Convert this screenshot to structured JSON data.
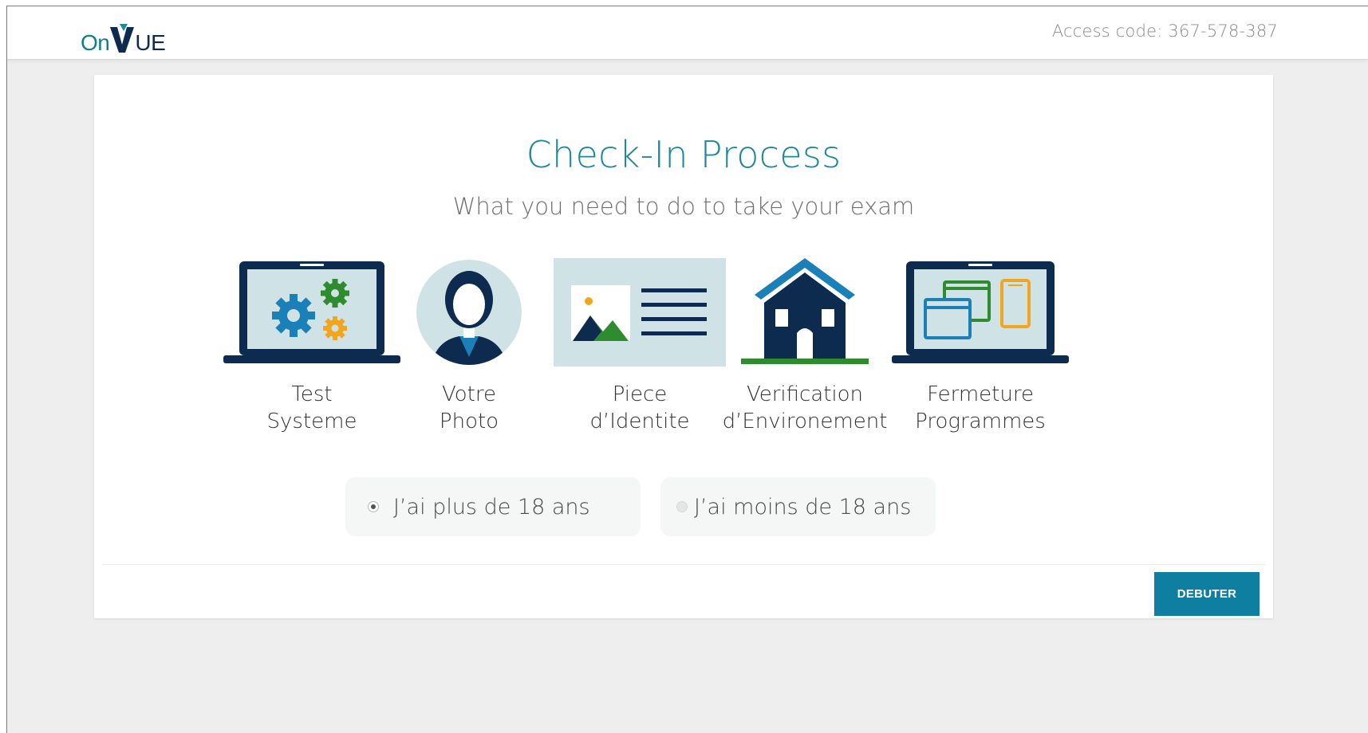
{
  "header": {
    "logo": {
      "on": "On",
      "ue": "UE"
    },
    "access_code": "Access code: 367-578-387"
  },
  "card": {
    "title": "Check-In Process",
    "subtitle": "What you need to do to take your exam",
    "steps": [
      {
        "label": "Test\nSysteme",
        "icon": "laptop-gears-icon"
      },
      {
        "label": "Votre\nPhoto",
        "icon": "person-photo-icon"
      },
      {
        "label": "Piece\nd’Identite",
        "icon": "id-card-icon"
      },
      {
        "label": "Verification\nd’Environement",
        "icon": "house-icon"
      },
      {
        "label": "Fermeture\nProgrammes",
        "icon": "laptop-windows-icon"
      }
    ],
    "age_options": [
      {
        "label": "J’ai plus de 18 ans",
        "selected": true
      },
      {
        "label": "J’ai moins de 18 ans",
        "selected": false
      }
    ],
    "start_button": "DEBUTER"
  },
  "colors": {
    "teal": "#1a8a9a",
    "navy": "#0d2b4e",
    "gear_blue": "#1b7fb8",
    "gear_green": "#2e8b2e",
    "gear_orange": "#f2a51f",
    "button": "#0e7fa0"
  }
}
